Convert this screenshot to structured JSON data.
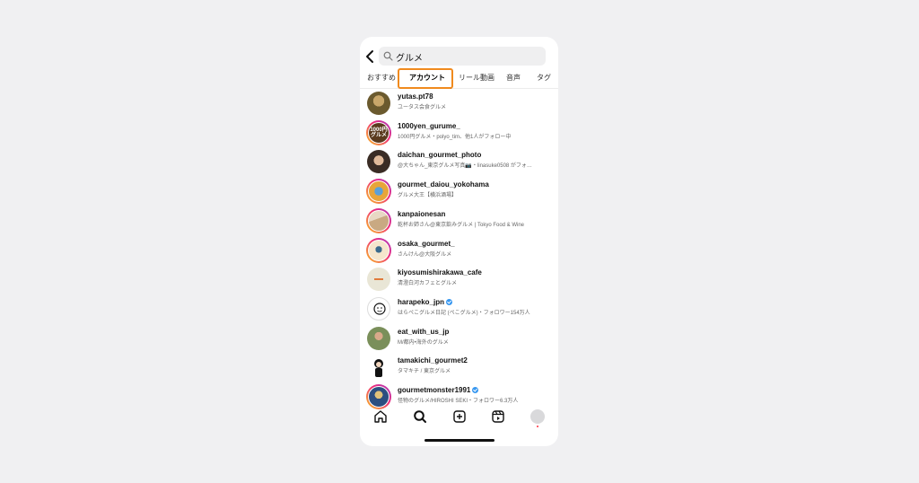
{
  "search": {
    "query": "グルメ"
  },
  "tabs": [
    {
      "label": "おすすめ"
    },
    {
      "label": "アカウント"
    },
    {
      "label": "リール動画"
    },
    {
      "label": "音声"
    },
    {
      "label": "タグ"
    }
  ],
  "active_tab": "アカウント",
  "accounts": [
    {
      "username": "yutas.pt78",
      "subtitle": "ユータス会食グルメ",
      "verified": false,
      "story_ring": false,
      "avatar_color": "#6b5a2e"
    },
    {
      "username": "1000yen_gurume_",
      "subtitle": "1000円グルメ・polyo_tim、他1人がフォロー中",
      "verified": false,
      "story_ring": true,
      "avatar_color": "#5a3a1e",
      "avatar_text": "1000円 グルメ"
    },
    {
      "username": "daichan_gourmet_photo",
      "subtitle": "@大ちゃん_東京グルメ写真📷・linasuke0508 がフォ…",
      "verified": false,
      "story_ring": false,
      "avatar_color": "#3a2c25"
    },
    {
      "username": "gourmet_daiou_yokohama",
      "subtitle": "グルメ大王【横浜酒場】",
      "verified": false,
      "story_ring": true,
      "avatar_color": "#e7a53a"
    },
    {
      "username": "kanpaionesan",
      "subtitle": "乾杯お姉さん@東京飲みグルメ | Tokyo Food & Wine",
      "verified": false,
      "story_ring": true,
      "avatar_color": "#c9a982"
    },
    {
      "username": "osaka_gourmet_",
      "subtitle": "さんけん@大阪グルメ",
      "verified": false,
      "story_ring": true,
      "avatar_color": "#f5e6cc"
    },
    {
      "username": "kiyosumishirakawa_cafe",
      "subtitle": "清澄白河カフェとグルメ",
      "verified": false,
      "story_ring": false,
      "avatar_color": "#e9e6d6"
    },
    {
      "username": "harapeko_jpn",
      "subtitle": "はらぺこグルメ日記 (ぺこグルメ)・フォロワー154万人",
      "verified": true,
      "story_ring": false,
      "avatar_color": "#ffffff"
    },
    {
      "username": "eat_with_us_jp",
      "subtitle": "M/都内•海外のグルメ",
      "verified": false,
      "story_ring": false,
      "avatar_color": "#7a8f5a"
    },
    {
      "username": "tamakichi_gourmet2",
      "subtitle": "タマキチ / 東京グルメ",
      "verified": false,
      "story_ring": false,
      "avatar_color": "#ffffff"
    },
    {
      "username": "gourmetmonster1991",
      "subtitle": "怪物のグルメ/HIROSHI SEKI・フォロワー6.3万人",
      "verified": true,
      "story_ring": true,
      "avatar_color": "#2c4f80"
    }
  ],
  "nav": [
    {
      "icon": "home-icon"
    },
    {
      "icon": "search-icon"
    },
    {
      "icon": "create-icon"
    },
    {
      "icon": "reels-icon"
    },
    {
      "icon": "profile-avatar"
    }
  ],
  "colors": {
    "highlight": "#f08a1e",
    "verified": "#3797f0"
  }
}
